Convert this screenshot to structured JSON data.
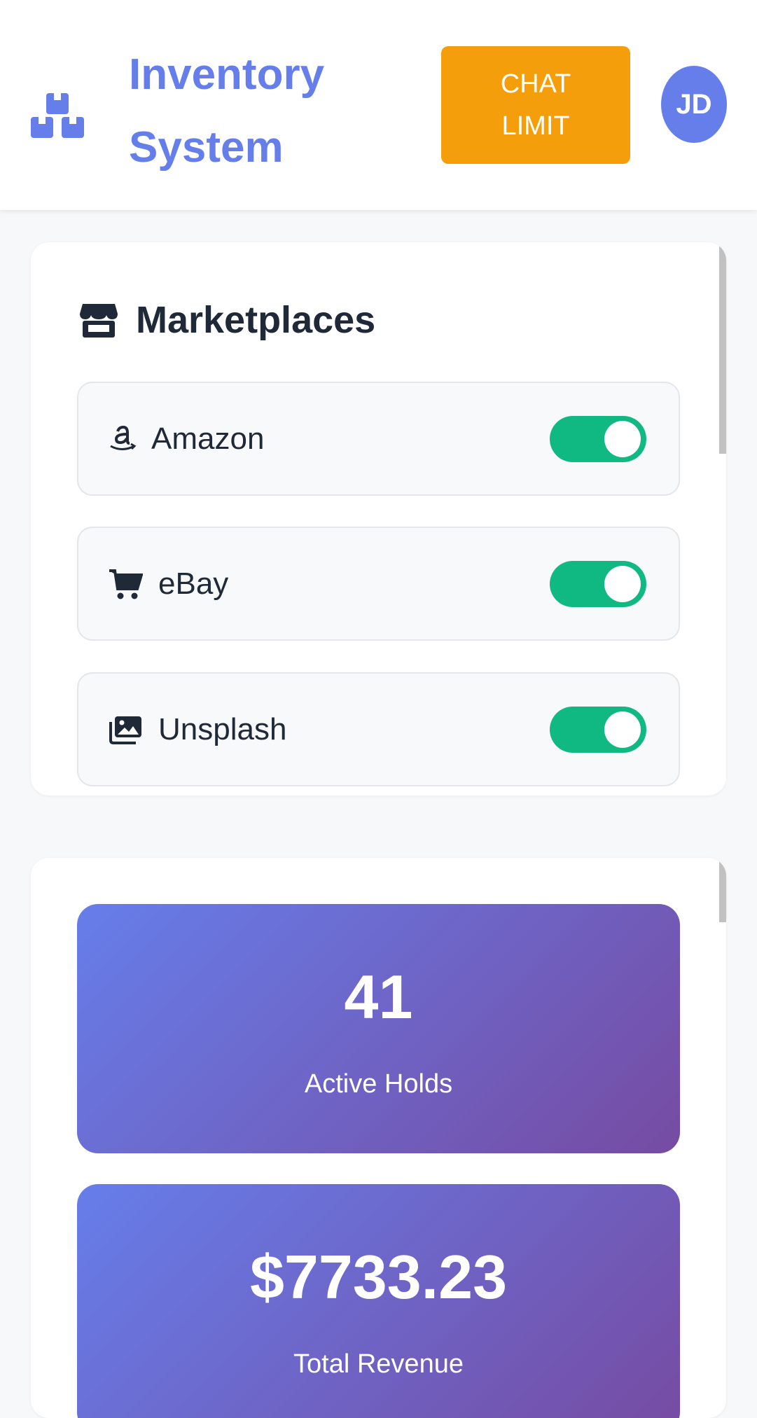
{
  "header": {
    "title_line1": "Inventory",
    "title_line2": "System",
    "chat_limit_line1": "CHAT",
    "chat_limit_line2": "LIMIT",
    "avatar_initials": "JD",
    "brand_icon": "boxes-icon"
  },
  "marketplaces": {
    "title": "Marketplaces",
    "title_icon": "store-icon",
    "items": [
      {
        "label": "Amazon",
        "icon": "amazon-icon",
        "enabled": true
      },
      {
        "label": "eBay",
        "icon": "cart-icon",
        "enabled": true
      },
      {
        "label": "Unsplash",
        "icon": "images-icon",
        "enabled": true
      }
    ]
  },
  "stats": [
    {
      "value": "41",
      "label": "Active Holds"
    },
    {
      "value": "$7733.23",
      "label": "Total Revenue"
    }
  ],
  "colors": {
    "accent": "#667eea",
    "gradient_end": "#764ba2",
    "warning": "#f59e0b",
    "toggle_on": "#10b981"
  }
}
